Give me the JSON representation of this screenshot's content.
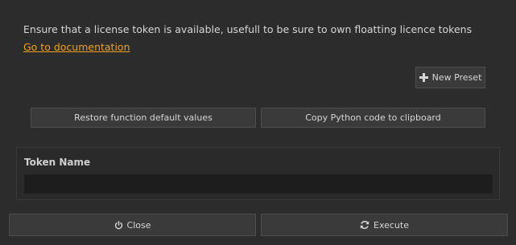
{
  "dialog": {
    "description": "Ensure that a license token is available, usefull to be sure to own floatting licence tokens",
    "documentation_link": "Go to documentation"
  },
  "toolbar": {
    "new_preset_label": "New Preset",
    "new_preset_icon": "plus-icon"
  },
  "actions": {
    "restore_label": "Restore function default values",
    "copy_python_label": "Copy Python code to clipboard"
  },
  "parameters": {
    "token_name_label": "Token Name",
    "token_name_value": ""
  },
  "footer": {
    "close_label": "Close",
    "close_icon": "power-icon",
    "execute_label": "Execute",
    "execute_icon": "refresh-icon"
  },
  "colors": {
    "background": "#2c2c2c",
    "link": "#f0a020",
    "button_bg": "#3a3a3a",
    "input_bg": "#1d1d1d"
  }
}
